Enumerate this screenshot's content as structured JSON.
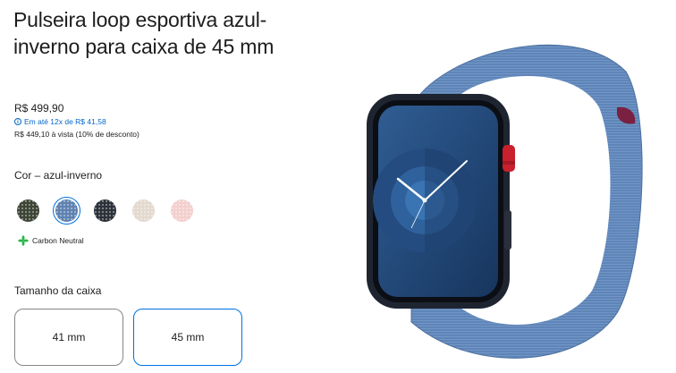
{
  "product": {
    "title": "Pulseira loop esportiva azul-inverno para caixa de 45 mm",
    "price": "R$ 499,90",
    "installment": "Em até 12x de R$ 41,58",
    "cash_price": "R$ 449,10 à vista (10% de desconto)"
  },
  "color": {
    "label": "Cor – azul-inverno",
    "swatches": [
      {
        "name": "verde-musgo",
        "hex": "#3d4536"
      },
      {
        "name": "azul-inverno",
        "hex": "#5f82b1",
        "selected": true
      },
      {
        "name": "meia-noite",
        "hex": "#2d313a"
      },
      {
        "name": "estelar",
        "hex": "#e3d9cf"
      },
      {
        "name": "rosa",
        "hex": "#f3cfcd"
      }
    ]
  },
  "carbon": {
    "label": "Carbon Neutral",
    "color": "#2ab54a"
  },
  "size": {
    "label": "Tamanho da caixa",
    "options": [
      "41 mm",
      "45 mm"
    ],
    "selected": "45 mm"
  },
  "colors": {
    "accent": "#0071e3",
    "link": "#0066cc",
    "band": "#5f85b8",
    "case": "#1f2530",
    "crown_red": "#c8202d"
  }
}
